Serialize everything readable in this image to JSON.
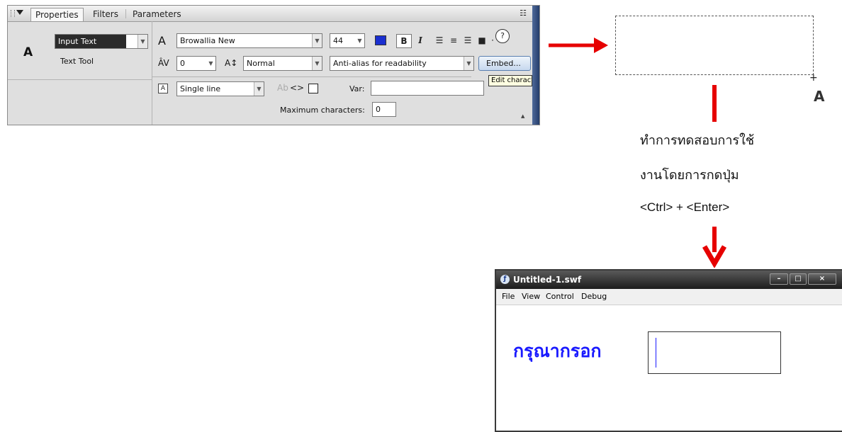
{
  "panel": {
    "tabs": [
      "Properties",
      "Filters",
      "Parameters"
    ],
    "text_type": "Input Text",
    "tool_name": "Text Tool",
    "font_family": "Browallia New",
    "font_size": "44",
    "letter_spacing": "0",
    "char_position": "Normal",
    "anti_alias": "Anti-alias for readability",
    "embed_button": "Embed...",
    "tooltip": "Edit character options",
    "line_type": "Single line",
    "var_label": "Var:",
    "var_value": "",
    "max_chars_label": "Maximum characters:",
    "max_chars_value": "0",
    "help_icon": "help-icon",
    "text_color": "#1a2fd0"
  },
  "stage": {
    "cursor_glyph": "A"
  },
  "instruction": {
    "line1": "ทำการทดสอบการใช้",
    "line2": "งานโดยการกดปุ่ม",
    "line3": "<Ctrl> + <Enter>"
  },
  "swf_window": {
    "title": "Untitled-1.swf",
    "menu": [
      "File",
      "View",
      "Control",
      "Debug"
    ],
    "label": "กรุณากรอก",
    "label_color": "#1a1aff"
  },
  "colors": {
    "arrow": "#e60000"
  }
}
